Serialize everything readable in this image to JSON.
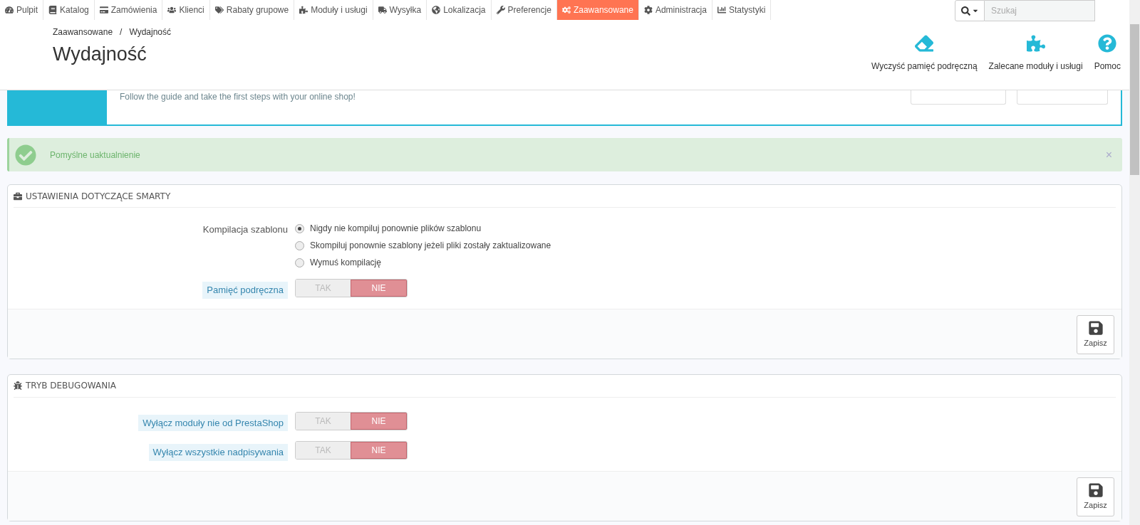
{
  "nav": [
    {
      "label": "Pulpit",
      "selected": false
    },
    {
      "label": "Katalog",
      "selected": false
    },
    {
      "label": "Zamówienia",
      "selected": false
    },
    {
      "label": "Klienci",
      "selected": false
    },
    {
      "label": "Rabaty grupowe",
      "selected": false
    },
    {
      "label": "Moduły i usługi",
      "selected": false
    },
    {
      "label": "Wysyłka",
      "selected": false
    },
    {
      "label": "Lokalizacja",
      "selected": false
    },
    {
      "label": "Preferencje",
      "selected": false
    },
    {
      "label": "Zaawansowane",
      "selected": true
    },
    {
      "label": "Administracja",
      "selected": false
    },
    {
      "label": "Statystyki",
      "selected": false
    }
  ],
  "search": {
    "placeholder": "Szukaj"
  },
  "breadcrumb": {
    "items": [
      "Zaawansowane",
      "Wydajność"
    ],
    "separator": "/"
  },
  "page_title": "Wydajność",
  "toolbar": [
    {
      "label": "Wyczyść pamięć podręczną"
    },
    {
      "label": "Zalecane moduły i usługi"
    },
    {
      "label": "Pomoc"
    }
  ],
  "onboarding": {
    "text": "Follow the guide and take the first steps with your online shop!"
  },
  "alert": {
    "text": "Pomyślne uaktualnienie",
    "close": "×"
  },
  "panels": [
    {
      "title": "USTAWIENIA DOTYCZĄCE SMARTY",
      "save": "Zapisz",
      "fields": [
        {
          "kind": "radio",
          "label": "Kompilacja szablonu",
          "options": [
            {
              "label": "Nigdy nie kompiluj ponownie plików szablonu",
              "selected": true
            },
            {
              "label": "Skompiluj ponownie szablony jeżeli pliki zostały zaktualizowane",
              "selected": false
            },
            {
              "label": "Wymuś kompilację",
              "selected": false
            }
          ]
        },
        {
          "kind": "switch",
          "label": "Pamięć podręczna",
          "options": [
            {
              "label": "TAK",
              "selected": false
            },
            {
              "label": "NIE",
              "selected": true
            }
          ]
        }
      ]
    },
    {
      "title": "TRYB DEBUGOWANIA",
      "save": "Zapisz",
      "fields": [
        {
          "kind": "switch",
          "label": "Wyłącz moduły nie od PrestaShop",
          "options": [
            {
              "label": "TAK",
              "selected": false
            },
            {
              "label": "NIE",
              "selected": true
            }
          ]
        },
        {
          "kind": "switch",
          "label": "Wyłącz wszystkie nadpisywania",
          "options": [
            {
              "label": "TAK",
              "selected": false
            },
            {
              "label": "NIE",
              "selected": true
            }
          ]
        }
      ]
    }
  ]
}
